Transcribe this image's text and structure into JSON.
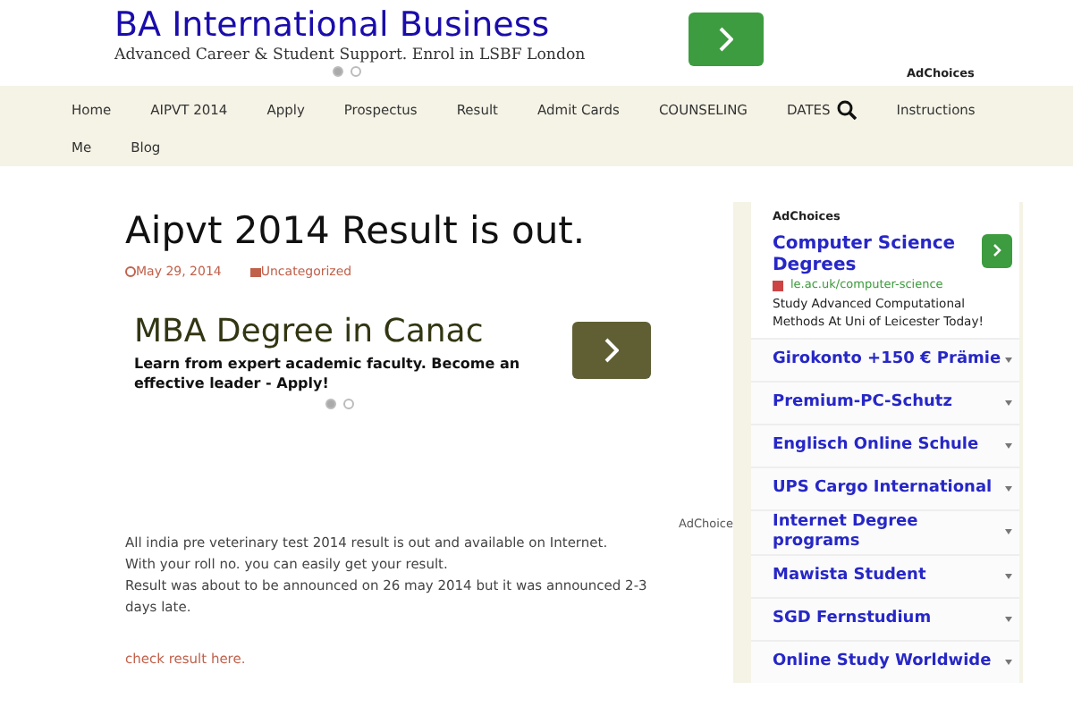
{
  "top_ad": {
    "title": "BA International Business",
    "text": "Advanced Career & Student Support. Enrol in LSBF London",
    "dots": [
      {
        "selected": true
      },
      {
        "selected": false
      }
    ],
    "adchoices": "AdChoices"
  },
  "nav": {
    "items": [
      {
        "label": "Home"
      },
      {
        "label": "AIPVT 2014"
      },
      {
        "label": "Apply"
      },
      {
        "label": "Prospectus"
      },
      {
        "label": "Result"
      },
      {
        "label": "Admit Cards"
      },
      {
        "label": "COUNSELING"
      },
      {
        "label": "DATES"
      },
      {
        "label": "Instructions"
      },
      {
        "label": "Me"
      },
      {
        "label": "Blog"
      }
    ]
  },
  "post": {
    "title": "Aipvt 2014 Result is out.",
    "date": "May 29, 2014",
    "category": "Uncategorized",
    "ad": {
      "title": "MBA Degree in Canac",
      "text": "Learn from expert academic faculty. Become an effective leader - Apply!",
      "dots": [
        {
          "selected": true
        },
        {
          "selected": false
        }
      ]
    },
    "adchoice": "AdChoice",
    "lines": [
      "All india pre veterinary test 2014 result is out and available on Internet.",
      "With your roll no. you can easily get your result.",
      "Result was about to be announced on 26 may 2014 but it was announced 2-3 days late."
    ],
    "link": "check result here."
  },
  "sidebar": {
    "adchoices": "AdChoices",
    "ad_title": "Computer Science Degrees",
    "ad_url": "le.ac.uk/computer-science",
    "ad_text": "Study Advanced Computational Methods At Uni of Leicester Today!",
    "links": [
      "Girokonto +150 € Prämie",
      "Premium-PC-Schutz",
      "Englisch Online Schule",
      "UPS Cargo International",
      "Internet Degree programs",
      "Mawista Student",
      "SGD Fernstudium",
      "Online Study Worldwide"
    ]
  }
}
